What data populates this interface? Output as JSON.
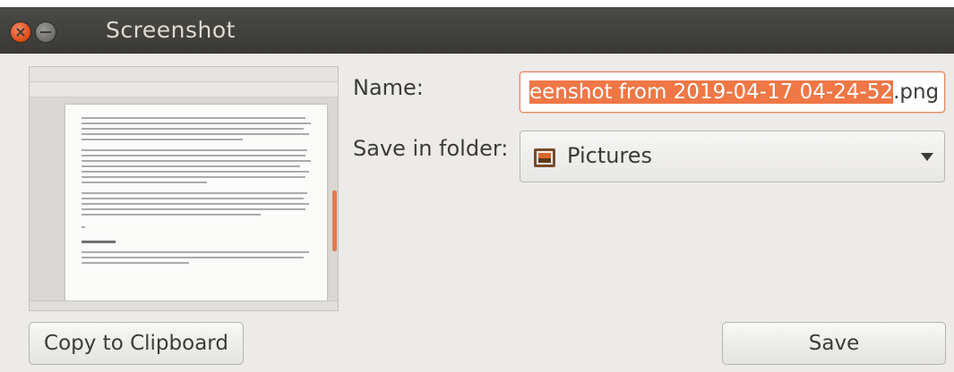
{
  "window": {
    "title": "Screenshot"
  },
  "form": {
    "name_label": "Name:",
    "name_selected": "eenshot from 2019-04-17 04-24-52",
    "name_suffix": ".png",
    "folder_label": "Save in folder:",
    "folder_value": "Pictures",
    "folder_icon": "pictures-folder-icon"
  },
  "buttons": {
    "copy": "Copy to Clipboard",
    "save": "Save"
  },
  "colors": {
    "accent": "#f07746",
    "titlebar": "#3c3b37",
    "close": "#dd4814",
    "background": "#ecebe9"
  }
}
